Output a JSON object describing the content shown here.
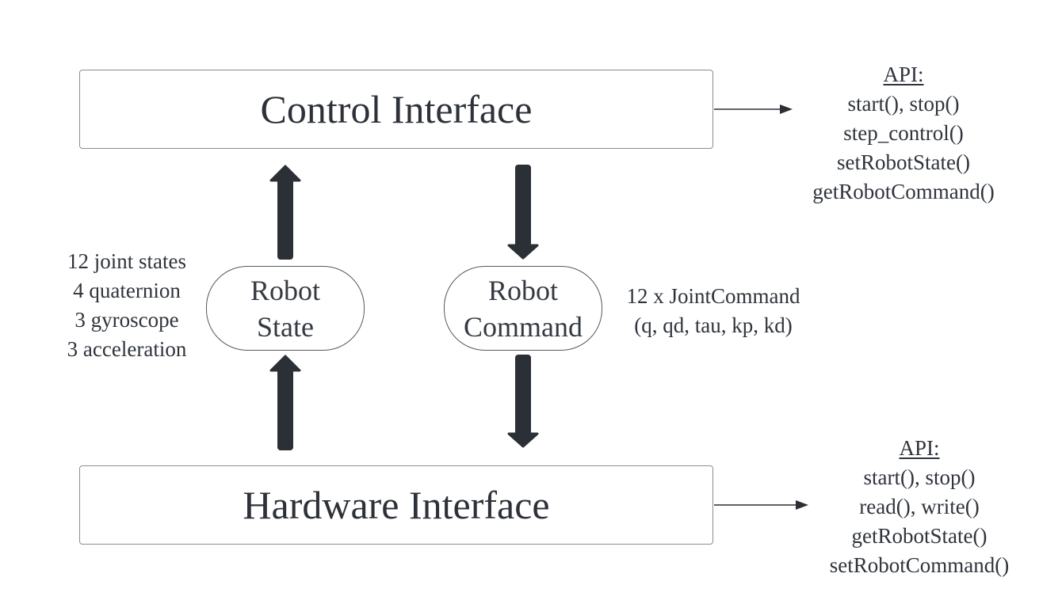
{
  "control_interface": {
    "title": "Control Interface",
    "api": {
      "heading": "API:",
      "methods": [
        "start(), stop()",
        "step_control()",
        "setRobotState()",
        "getRobotCommand()"
      ]
    }
  },
  "hardware_interface": {
    "title": "Hardware Interface",
    "api": {
      "heading": "API:",
      "methods": [
        "start(), stop()",
        "read(), write()",
        "getRobotState()",
        "setRobotCommand()"
      ]
    }
  },
  "robot_state": {
    "label_line1": "Robot",
    "label_line2": "State",
    "contents": [
      "12 joint states",
      "4 quaternion",
      "3 gyroscope",
      "3 acceleration"
    ]
  },
  "robot_command": {
    "label_line1": "Robot",
    "label_line2": "Command",
    "contents": [
      "12 x JointCommand",
      "(q, qd, tau, kp, kd)"
    ]
  },
  "colors": {
    "arrow": "#2b2f36",
    "box_border": "#8a8d91",
    "text": "#2f343c"
  }
}
